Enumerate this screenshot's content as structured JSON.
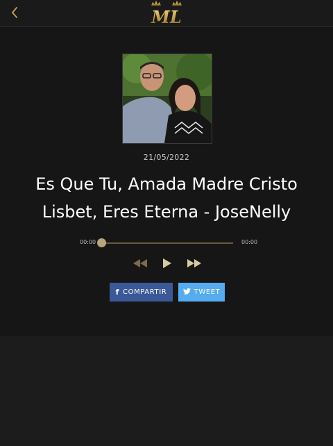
{
  "header": {
    "back_icon": "chevron-left-icon",
    "logo_text": "ML",
    "logo_icons": [
      "crown-icon",
      "crown-icon"
    ]
  },
  "song": {
    "date": "21/05/2022",
    "title": "Es Que Tu, Amada Madre Cristo Lisbet, Eres Eterna - JoseNelly"
  },
  "player": {
    "current_time": "00:00",
    "duration": "00:00",
    "progress": 0,
    "controls": [
      "rewind-icon",
      "play-icon",
      "fast-forward-icon"
    ]
  },
  "share": {
    "facebook_label": "COMPARTIR",
    "twitter_label": "TWEET"
  },
  "colors": {
    "accent_gold": "#c9a44a",
    "facebook": "#3b5998",
    "twitter": "#55acee"
  }
}
